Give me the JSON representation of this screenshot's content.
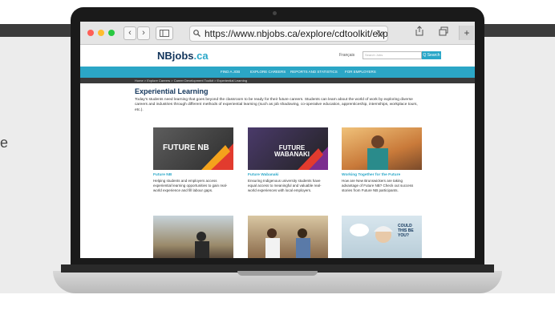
{
  "side_text": "e",
  "browser": {
    "url": "https://www.nbjobs.ca/explore/cdtoolkit/expe",
    "back": "‹",
    "forward": "›",
    "reload_icon": "reload-icon",
    "share_icon": "share-icon",
    "tabs_icon": "tabs-icon",
    "new_tab_icon": "plus-icon",
    "window_dots": [
      "#ff5f57",
      "#febc2e",
      "#28c840"
    ]
  },
  "site": {
    "logo_main": "NB",
    "logo_jobs": "jobs",
    "logo_suffix": ".ca",
    "lang_link": "Français",
    "search_placeholder": "Search Jobs",
    "search_button": "Q Search",
    "nav": [
      "FIND A JOB",
      "EXPLORE CAREERS",
      "REPORTS AND STATISTICS",
      "FOR EMPLOYERS"
    ],
    "breadcrumb": "Home  >  Explore Careers  >  Career Development Toolkit  >  Experiential Learning",
    "brand_color": "#2aa7c8",
    "navy_color": "#12355b"
  },
  "page": {
    "title": "Experiential Learning",
    "intro": "Today's students need learning that goes beyond the classroom to be ready for their future careers. Students can learn about the world of work by exploring diverse careers and industries through different methods of experiential learning (such as job shadowing, co-operative education, apprenticeship, internships, workplace tours, etc.).",
    "cards": [
      {
        "title": "Future NB",
        "desc": "Helping students and employers access experiential learning opportunities to gain real-world experience and fill labour gaps.",
        "image_text": "FUTURE NB"
      },
      {
        "title": "Future Wabanaki",
        "desc": "Ensuring Indigenous university students have equal access to meaningful and valuable real-world experiences with local employers.",
        "image_text": "FUTURE WABANAKI"
      },
      {
        "title": "Working Together for the Future",
        "desc": "How are New Brunswickers are taking advantage of Future NB? Check out success stories from Future NB participants.",
        "image_text": ""
      }
    ],
    "bottom_card_text": "COULD THIS BE YOU?"
  }
}
